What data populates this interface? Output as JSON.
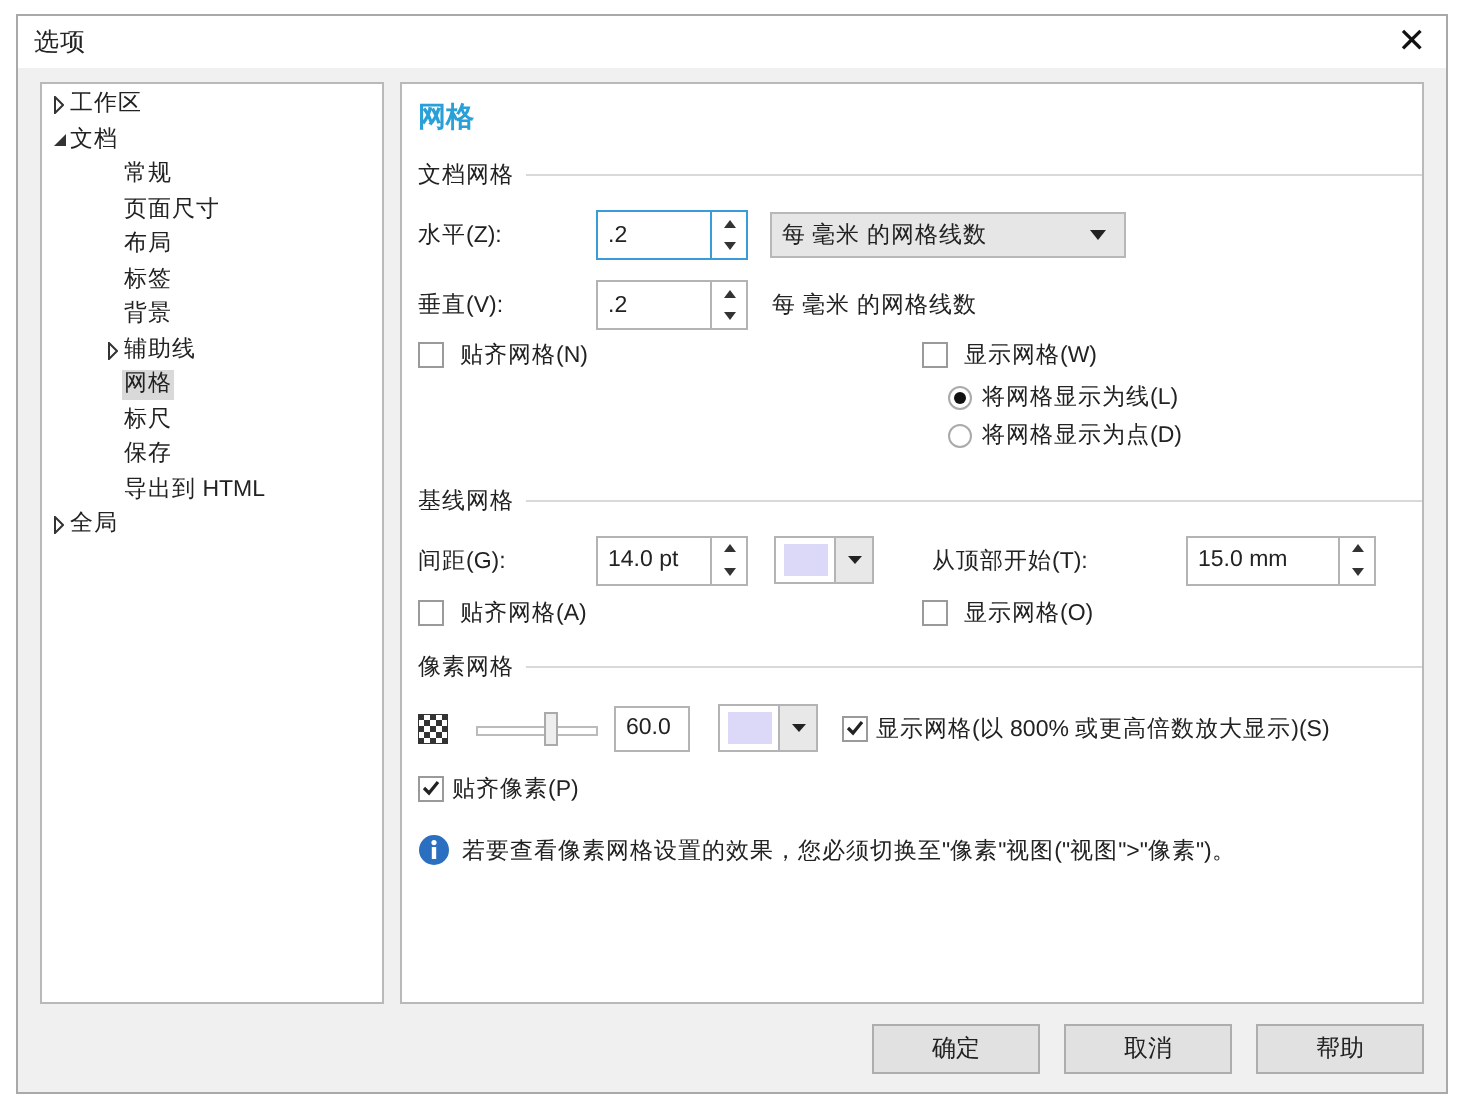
{
  "window": {
    "title": "选项",
    "close": "✕"
  },
  "tree": [
    {
      "label": "工作区",
      "expanded": false,
      "selected": false
    },
    {
      "label": "文档",
      "expanded": true,
      "selected": false,
      "children": [
        {
          "label": "常规",
          "selected": false
        },
        {
          "label": "页面尺寸",
          "selected": false
        },
        {
          "label": "布局",
          "selected": false
        },
        {
          "label": "标签",
          "selected": false
        },
        {
          "label": "背景",
          "selected": false
        },
        {
          "label": "辅助线",
          "expanded": false,
          "selected": false
        },
        {
          "label": "网格",
          "selected": true
        },
        {
          "label": "标尺",
          "selected": false
        },
        {
          "label": "保存",
          "selected": false
        },
        {
          "label": "导出到 HTML",
          "selected": false
        }
      ]
    },
    {
      "label": "全局",
      "expanded": false,
      "selected": false
    }
  ],
  "page": {
    "title": "网格"
  },
  "document_grid": {
    "heading": "文档网格",
    "horizontal": {
      "label": "水平(Z):",
      "value": ".2",
      "focused": true
    },
    "unit_dropdown": "每 毫米 的网格线数",
    "vertical": {
      "label": "垂直(V):",
      "value": ".2",
      "focused": false
    },
    "vertical_unit": "每 毫米 的网格线数",
    "snap": {
      "label": "贴齐网格(N)",
      "checked": false
    },
    "show": {
      "label": "显示网格(W)",
      "checked": false
    },
    "display_options": [
      {
        "label": "将网格显示为线(L)",
        "selected": true
      },
      {
        "label": "将网格显示为点(D)",
        "selected": false
      }
    ]
  },
  "baseline_grid": {
    "heading": "基线网格",
    "spacing": {
      "label": "间距(G):",
      "value": "14.0 pt",
      "focused": false
    },
    "color": "#dcd8f8",
    "start_from_top": {
      "label": "从顶部开始(T):",
      "value": "15.0 mm",
      "focused": false
    },
    "snap": {
      "label": "贴齐网格(A)",
      "checked": false
    },
    "show": {
      "label": "显示网格(O)",
      "checked": false
    }
  },
  "pixel_grid": {
    "heading": "像素网格",
    "opacity": {
      "level": 0.6,
      "value": "60.0"
    },
    "color": "#dcd8f8",
    "show": {
      "label": "显示网格(以 800% 或更高倍数放大显示)(S)",
      "checked": true
    },
    "snap_pixels": {
      "label": "贴齐像素(P)",
      "checked": true
    },
    "info": "若要查看像素网格设置的效果，您必须切换至\"像素\"视图(\"视图\">\"像素\")。"
  },
  "buttons": [
    "确定",
    "取消",
    "帮助"
  ]
}
